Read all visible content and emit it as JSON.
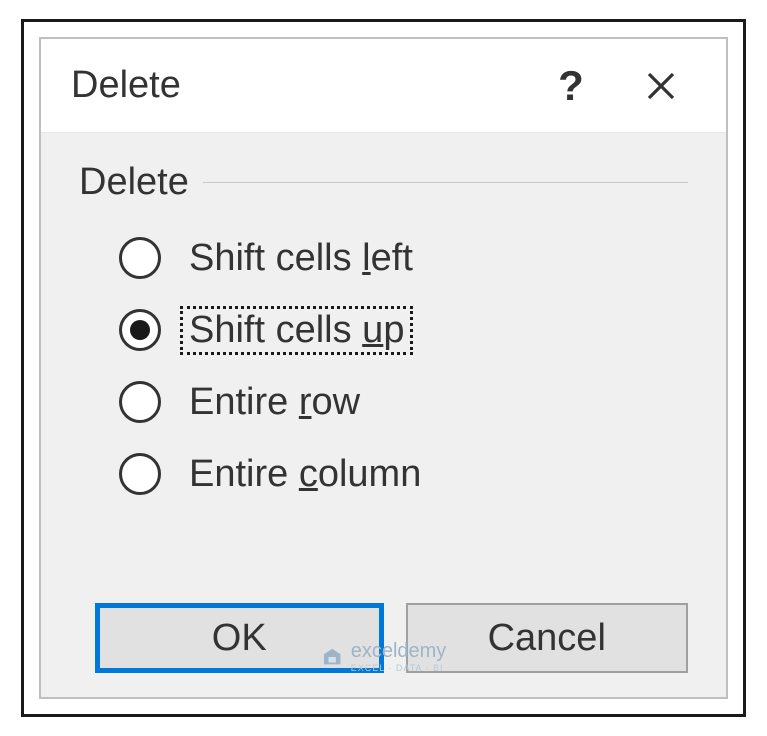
{
  "dialog": {
    "title": "Delete",
    "group_label": "Delete",
    "options": [
      {
        "pre": "Shift cells ",
        "key": "l",
        "post": "eft",
        "selected": false,
        "focused": false
      },
      {
        "pre": "Shift cells ",
        "key": "u",
        "post": "p",
        "selected": true,
        "focused": true
      },
      {
        "pre": "Entire ",
        "key": "r",
        "post": "ow",
        "selected": false,
        "focused": false
      },
      {
        "pre": "Entire ",
        "key": "c",
        "post": "olumn",
        "selected": false,
        "focused": false
      }
    ],
    "buttons": {
      "ok": "OK",
      "cancel": "Cancel"
    }
  },
  "watermark": {
    "brand": "exceldemy",
    "tagline": "EXCEL · DATA · BI"
  }
}
